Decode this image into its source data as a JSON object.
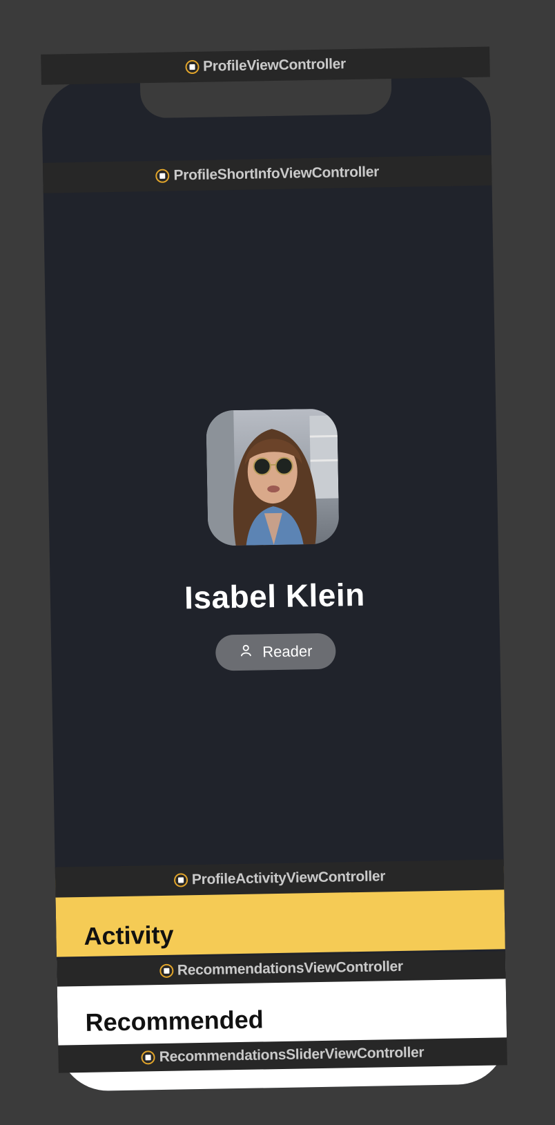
{
  "labels": {
    "profile_vc": "ProfileViewController",
    "short_info_vc": "ProfileShortInfoViewController",
    "activity_vc": "ProfileActivityViewController",
    "recommendations_vc": "RecommendationsViewController",
    "slider_vc": "RecommendationsSliderViewController"
  },
  "profile": {
    "name": "Isabel Klein",
    "role": "Reader",
    "role_icon": "person-icon"
  },
  "activity": {
    "title": "Activity"
  },
  "recommended": {
    "title": "Recommended"
  },
  "colors": {
    "background": "#3b3b3b",
    "screen": "#20232b",
    "label_bar": "#272727",
    "label_accent": "#e2a52a",
    "activity_accent": "#f5cb55",
    "pill": "#6b6d72"
  }
}
